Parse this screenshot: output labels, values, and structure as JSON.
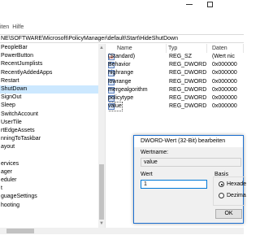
{
  "menu": {
    "items": [
      "iten",
      "Hilfe"
    ]
  },
  "address_path": "NE\\SOFTWARE\\Microsoft\\PolicyManager\\default\\Start\\HideShutDown",
  "tree": {
    "items": [
      {
        "label": "PeopleBar",
        "selected": false
      },
      {
        "label": "PowerButton",
        "selected": false
      },
      {
        "label": "RecentJumplists",
        "selected": false
      },
      {
        "label": "RecentlyAddedApps",
        "selected": false
      },
      {
        "label": "Restart",
        "selected": false
      },
      {
        "label": "ShutDown",
        "selected": true
      },
      {
        "label": "SignOut",
        "selected": false
      },
      {
        "label": "Sleep",
        "selected": false
      },
      {
        "label": "SwitchAccount",
        "selected": false
      },
      {
        "label": "UserTile",
        "selected": false
      },
      {
        "label": "rtEdgeAssets",
        "selected": false
      },
      {
        "label": "nningToTaskbar",
        "selected": false
      },
      {
        "label": "ayout",
        "selected": false
      },
      {
        "label": "",
        "selected": false
      },
      {
        "label": "ervices",
        "selected": false
      },
      {
        "label": "ager",
        "selected": false
      },
      {
        "label": "eduler",
        "selected": false
      },
      {
        "label": "t",
        "selected": false
      },
      {
        "label": "guageSettings",
        "selected": false
      },
      {
        "label": "hooting",
        "selected": false
      },
      {
        "label": "",
        "selected": false
      }
    ]
  },
  "values": {
    "headers": {
      "name": "Name",
      "type": "Typ",
      "data": "Daten"
    },
    "rows": [
      {
        "icon": "string-value-icon",
        "name": "(Standard)",
        "type": "REG_SZ",
        "data": "(Wert nic"
      },
      {
        "icon": "dword-value-icon",
        "name": "Behavior",
        "type": "REG_DWORD",
        "data": "0x000000"
      },
      {
        "icon": "dword-value-icon",
        "name": "highrange",
        "type": "REG_DWORD",
        "data": "0x000000"
      },
      {
        "icon": "dword-value-icon",
        "name": "lowrange",
        "type": "REG_DWORD",
        "data": "0x000000"
      },
      {
        "icon": "dword-value-icon",
        "name": "mergealgorithm",
        "type": "REG_DWORD",
        "data": "0x000000"
      },
      {
        "icon": "dword-value-icon",
        "name": "policytype",
        "type": "REG_DWORD",
        "data": "0x000000"
      },
      {
        "icon": "dword-value-icon",
        "name": "value",
        "type": "REG_DWORD",
        "data": "0x000000"
      }
    ]
  },
  "dialog": {
    "title": "DWORD-Wert (32-Bit) bearbeiten",
    "name_label": "Wertname:",
    "name_value": "value",
    "data_label": "Wert",
    "data_value": "1",
    "base_label": "Basis",
    "radio_hex": "Hexade",
    "radio_dec": "Dezima",
    "hex_checked": true,
    "ok_label": "OK"
  }
}
